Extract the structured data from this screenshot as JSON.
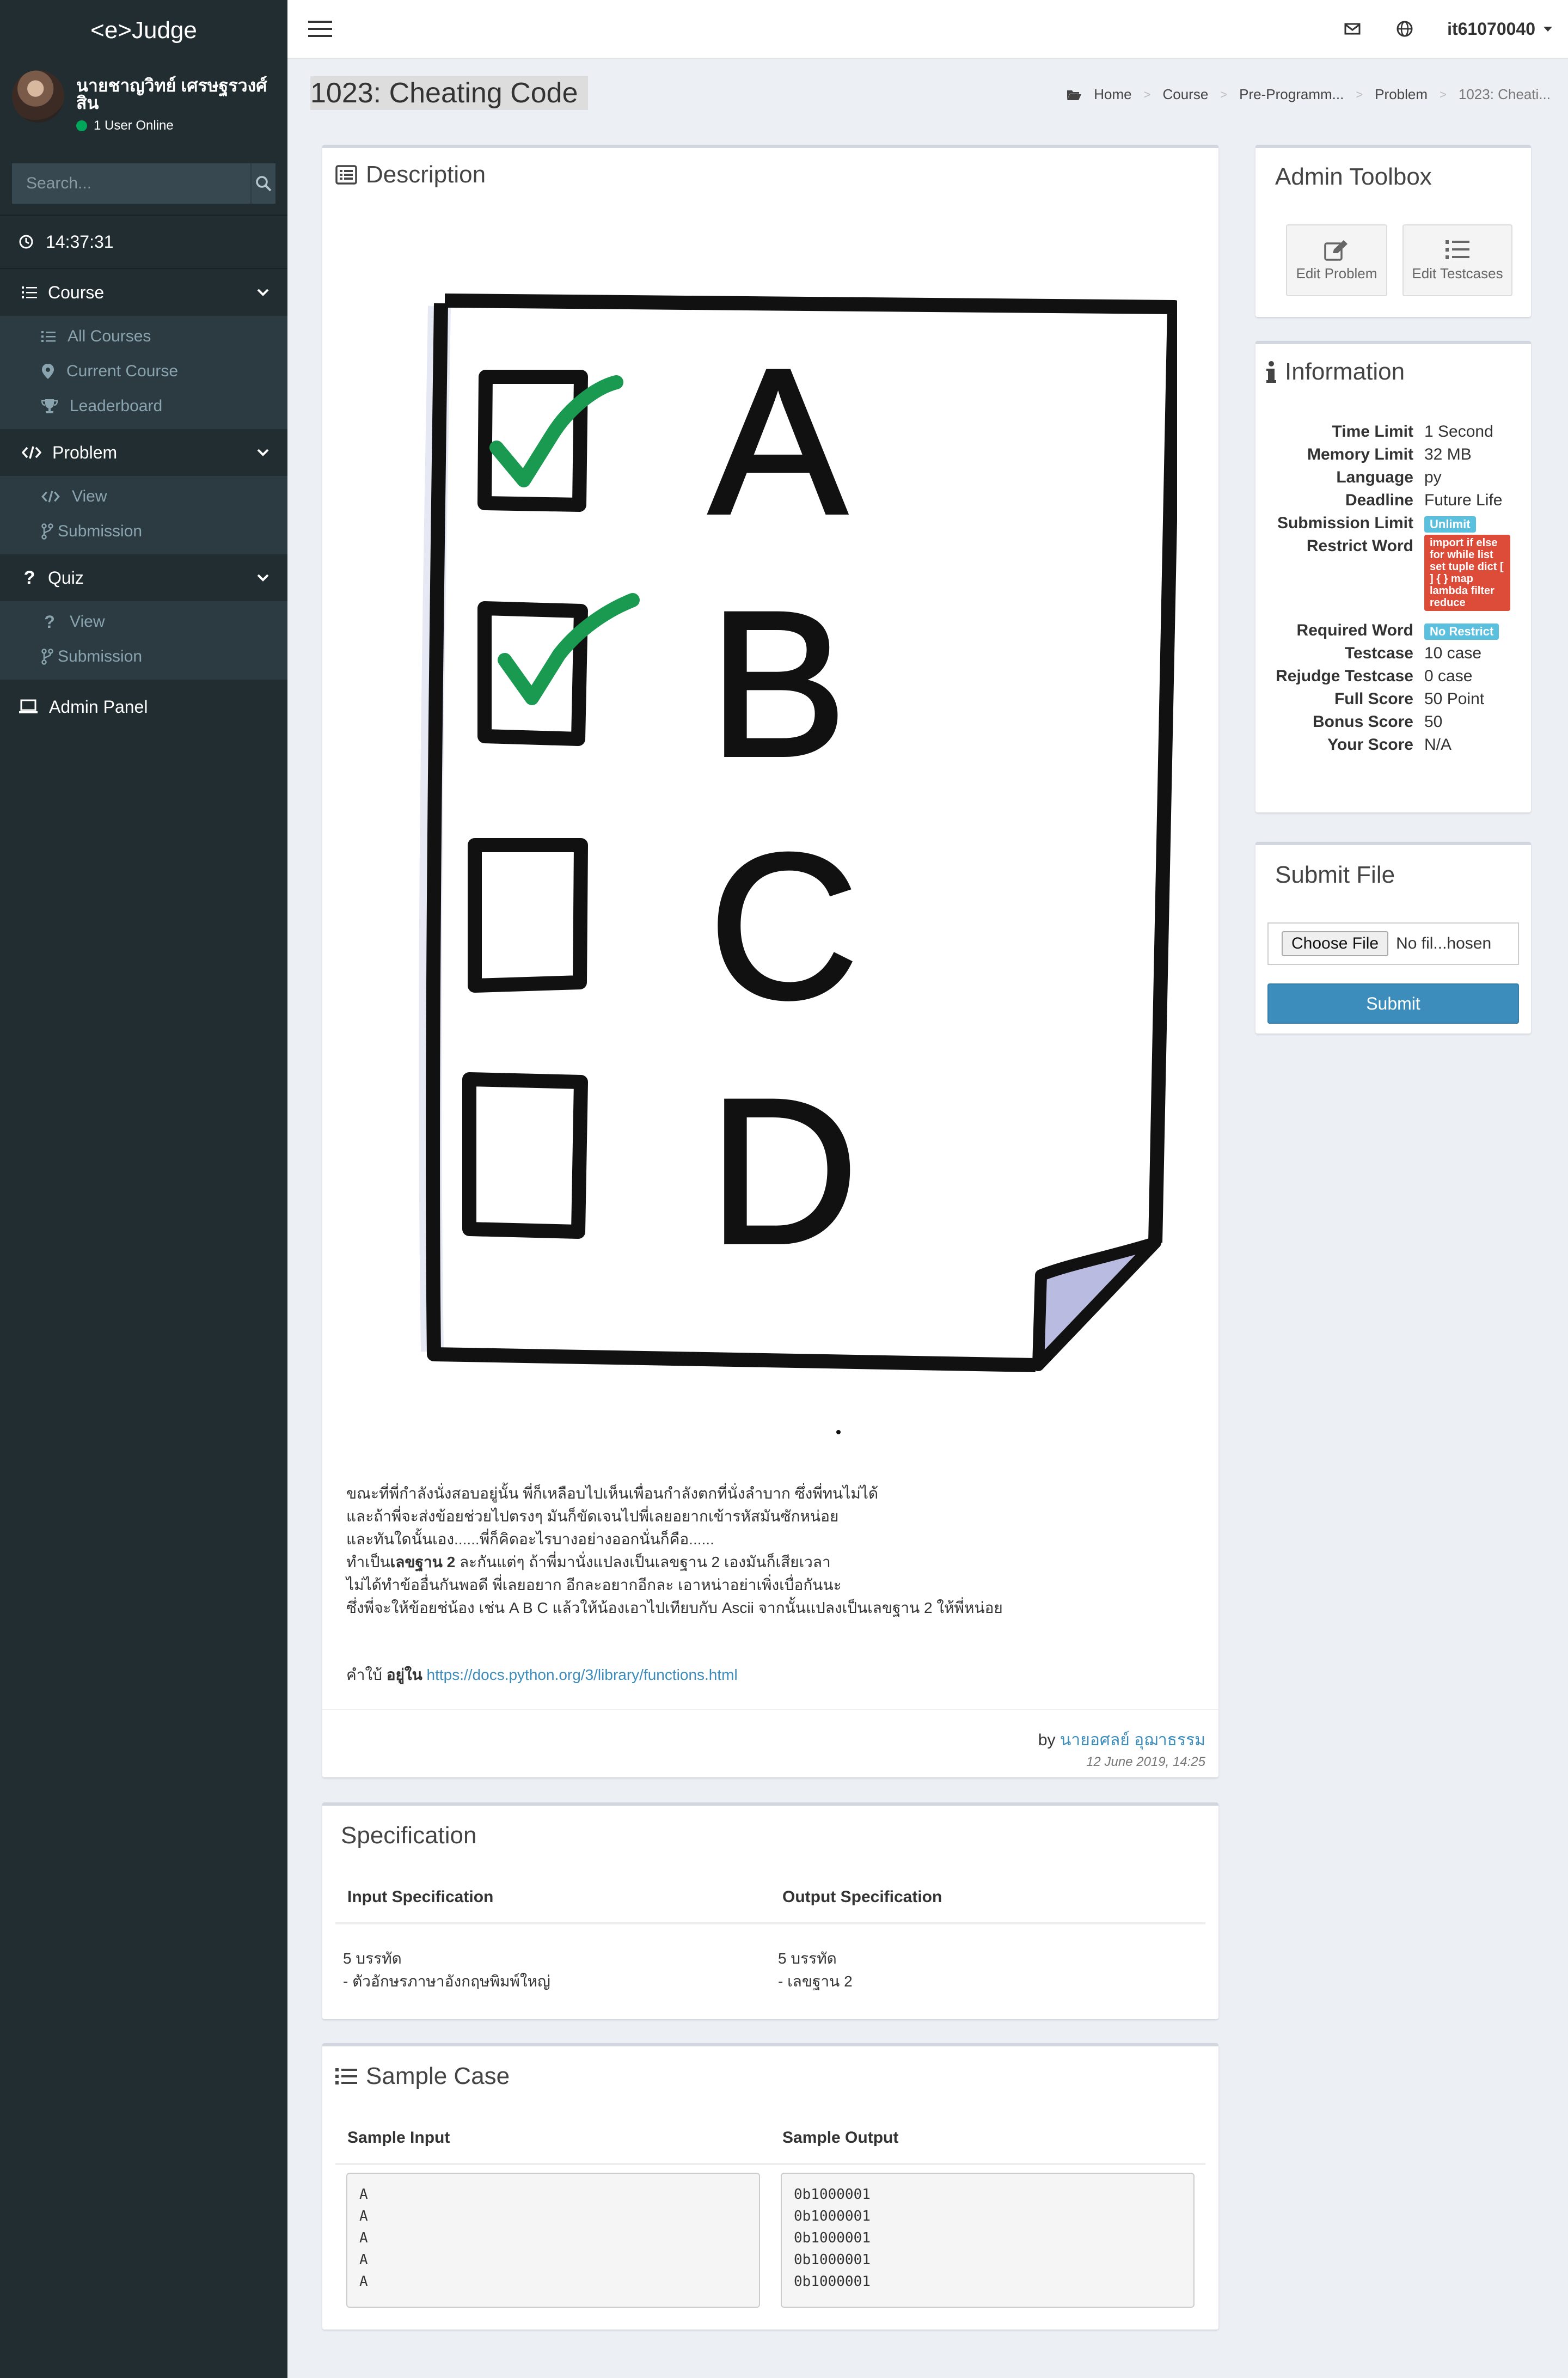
{
  "sidebar": {
    "logo": "<e>Judge",
    "user_name": "นายชาญวิทย์ เศรษฐรวงศ์สิน",
    "online_text": "1 User Online",
    "search_placeholder": "Search...",
    "clock": "14:37:31",
    "menus": [
      {
        "label": "Course",
        "items": [
          "All Courses",
          "Current Course",
          "Leaderboard"
        ]
      },
      {
        "label": "Problem",
        "items": [
          "View",
          "Submission"
        ]
      },
      {
        "label": "Quiz",
        "items": [
          "View",
          "Submission"
        ]
      }
    ],
    "admin_panel": "Admin Panel"
  },
  "header": {
    "username": "it61070040"
  },
  "page": {
    "title": "1023: Cheating Code",
    "breadcrumb": [
      "Home",
      "Course",
      "Pre-Programm...",
      "Problem",
      "1023: Cheati..."
    ]
  },
  "description": {
    "title": "Description",
    "sketch_letters": [
      "A",
      "B",
      "C",
      "D"
    ],
    "lines": [
      "ขณะที่พี่กำลังนั่งสอบอยู่นั้น พี่ก็เหลือบไปเห็นเพื่อนกำลังตกที่นั่งลำบาก ซึ่งพี่ทนไม่ได้",
      "และถ้าพี่จะส่งข้อยช่วยไปตรงๆ มันก็ขัดเจนไปพี่เลยอยากเข้ารหัสมันซักหน่อย",
      "และทันใดนั้นเอง......พี่ก็คิดอะไรบางอย่างออกนั่นก็คือ......"
    ],
    "line4_before": "ทำเป็น",
    "line4_bold": "เลขฐาน 2",
    "line4_after": " ละกันแต่ๆ ถ้าพี่มานั่งแปลงเป็นเลขฐาน 2 เองมันก็เสียเวลา",
    "lines2": [
      "ไม่ได้ทำข้ออื่นกันพอดี พี่เลยอยาก อีกละอยากอีกละ เอาหน่าอย่าเพิ่งเบื่อกันนะ",
      "ซึ่งพี่จะให้ข้อยช่น้อง เช่น A B C แล้วให้น้องเอาไปเทียบกับ Ascii จากนั้นแปลงเป็นเลขฐาน 2 ให้พี่หน่อย"
    ],
    "hint_prefix": "คำใบ้ ",
    "hint_bold": "อยู่ใน",
    "hint_link": "https://docs.python.org/3/library/functions.html",
    "by_prefix": "by",
    "author": "นายอศลย์ อุฌาธรรม",
    "date": "12 June 2019, 14:25"
  },
  "specification": {
    "title": "Specification",
    "input_header": "Input Specification",
    "output_header": "Output Specification",
    "input_text": "5 บรรทัด\n- ตัวอักษรภาษาอังกฤษพิมพ์ใหญ่",
    "output_text": "5 บรรทัด\n- เลขฐาน 2"
  },
  "sample": {
    "title": "Sample Case",
    "input_header": "Sample Input",
    "output_header": "Sample Output",
    "input": "A\nA\nA\nA\nA",
    "output": "0b1000001\n0b1000001\n0b1000001\n0b1000001\n0b1000001"
  },
  "admin_toolbox": {
    "title": "Admin Toolbox",
    "edit_problem": "Edit Problem",
    "edit_testcases": "Edit Testcases"
  },
  "information": {
    "title": "Information",
    "time_limit_k": "Time Limit",
    "time_limit_v": "1 Second",
    "memory_limit_k": "Memory Limit",
    "memory_limit_v": "32 MB",
    "language_k": "Language",
    "language_v": "py",
    "deadline_k": "Deadline",
    "deadline_v": "Future Life",
    "submission_limit_k": "Submission Limit",
    "submission_limit_v": "Unlimit",
    "restrict_word_k": "Restrict Word",
    "restrict_word_v": "import if else for while list set tuple dict [ ] { } map lambda filter reduce",
    "required_word_k": "Required Word",
    "required_word_v": "No Restrict",
    "testcase_k": "Testcase",
    "testcase_v": "10 case",
    "rejudge_k": "Rejudge Testcase",
    "rejudge_v": "0 case",
    "full_score_k": "Full Score",
    "full_score_v": "50 Point",
    "bonus_score_k": "Bonus Score",
    "bonus_score_v": "50",
    "your_score_k": "Your Score",
    "your_score_v": "N/A"
  },
  "submit": {
    "title": "Submit File",
    "choose_label": "Choose File",
    "file_status": "No fil...hosen",
    "submit_label": "Submit"
  },
  "colors": {
    "sidebar_bg": "#222d32",
    "accent": "#3c8dbc",
    "check_green": "#1a9a50",
    "badge_red": "#dd4b39",
    "badge_blue": "#5bc0de"
  }
}
